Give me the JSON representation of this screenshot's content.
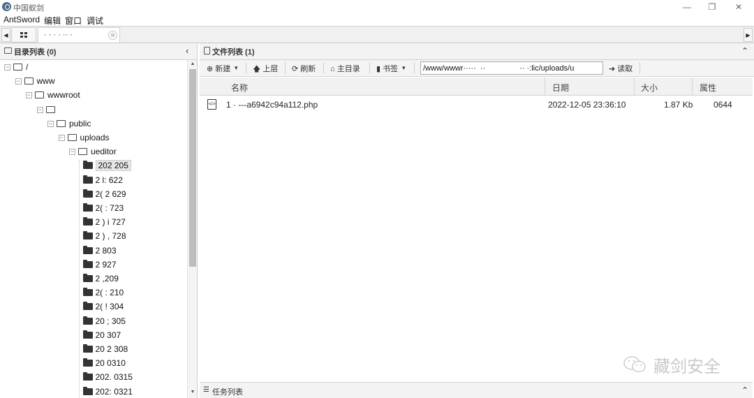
{
  "window": {
    "title": "中国蚁剑",
    "minimize": "—",
    "restore": "❐",
    "close": "✕"
  },
  "menu": {
    "items": [
      "AntSword",
      "编辑",
      "窗口",
      "调试"
    ]
  },
  "tabs": {
    "session_label": "·  ·      · ·  ··  ·",
    "close_glyph": "⊗",
    "left_arrow": "◀",
    "right_arrow": "▶"
  },
  "left_panel": {
    "title": "目录列表 (0)",
    "collapse_glyph": "‹",
    "tree": [
      {
        "label": "/",
        "depth": 0,
        "open": true
      },
      {
        "label": "www",
        "depth": 1,
        "open": true
      },
      {
        "label": "wwwroot",
        "depth": 2,
        "open": true
      },
      {
        "label": "",
        "depth": 3,
        "open": true
      },
      {
        "label": "public",
        "depth": 4,
        "open": true
      },
      {
        "label": "uploads",
        "depth": 5,
        "open": true
      },
      {
        "label": "ueditor",
        "depth": 6,
        "open": true
      },
      {
        "label": "202  205",
        "depth": 7,
        "open": false,
        "selected": true
      },
      {
        "label": "2 l:  622",
        "depth": 7,
        "open": false
      },
      {
        "label": "2( 2  629",
        "depth": 7,
        "open": false
      },
      {
        "label": "2( :  723",
        "depth": 7,
        "open": false
      },
      {
        "label": "2 ) i  727",
        "depth": 7,
        "open": false
      },
      {
        "label": "2 )  ,  728",
        "depth": 7,
        "open": false
      },
      {
        "label": "2    803",
        "depth": 7,
        "open": false
      },
      {
        "label": "2    927",
        "depth": 7,
        "open": false
      },
      {
        "label": "2   ,209",
        "depth": 7,
        "open": false
      },
      {
        "label": "2(  :  210",
        "depth": 7,
        "open": false
      },
      {
        "label": "2(  !  304",
        "depth": 7,
        "open": false
      },
      {
        "label": "20  ;  305",
        "depth": 7,
        "open": false
      },
      {
        "label": "20   307",
        "depth": 7,
        "open": false
      },
      {
        "label": "20  2 308",
        "depth": 7,
        "open": false
      },
      {
        "label": "20   0310",
        "depth": 7,
        "open": false
      },
      {
        "label": "202. 0315",
        "depth": 7,
        "open": false
      },
      {
        "label": "202: 0321",
        "depth": 7,
        "open": false
      }
    ]
  },
  "right_panel": {
    "title": "文件列表 (1)",
    "collapse_glyph": "⌃",
    "toolbar": {
      "new": "⊕ 新建",
      "new_caret": "▾",
      "up": "🡅 上层",
      "refresh": "⟳ 刷新",
      "home": "⌂ 主目录",
      "bookmark": "▮ 书签",
      "bookmark_caret": "▾",
      "path_value": "/www/wwwr·····  ··                ·· ·:lic/uploads/u",
      "read": "➜ 读取"
    },
    "columns": {
      "name": "名称",
      "date": "日期",
      "size": "大小",
      "attr": "属性"
    },
    "files": [
      {
        "name": "1                 ·  ---a6942c94a112.php",
        "date": "2022-12-05 23:36:10",
        "size": "1.87 Kb",
        "attr": "0644"
      }
    ],
    "task_list": "任务列表",
    "task_collapse": "⌃"
  },
  "watermark": {
    "text": "藏剑安全"
  }
}
